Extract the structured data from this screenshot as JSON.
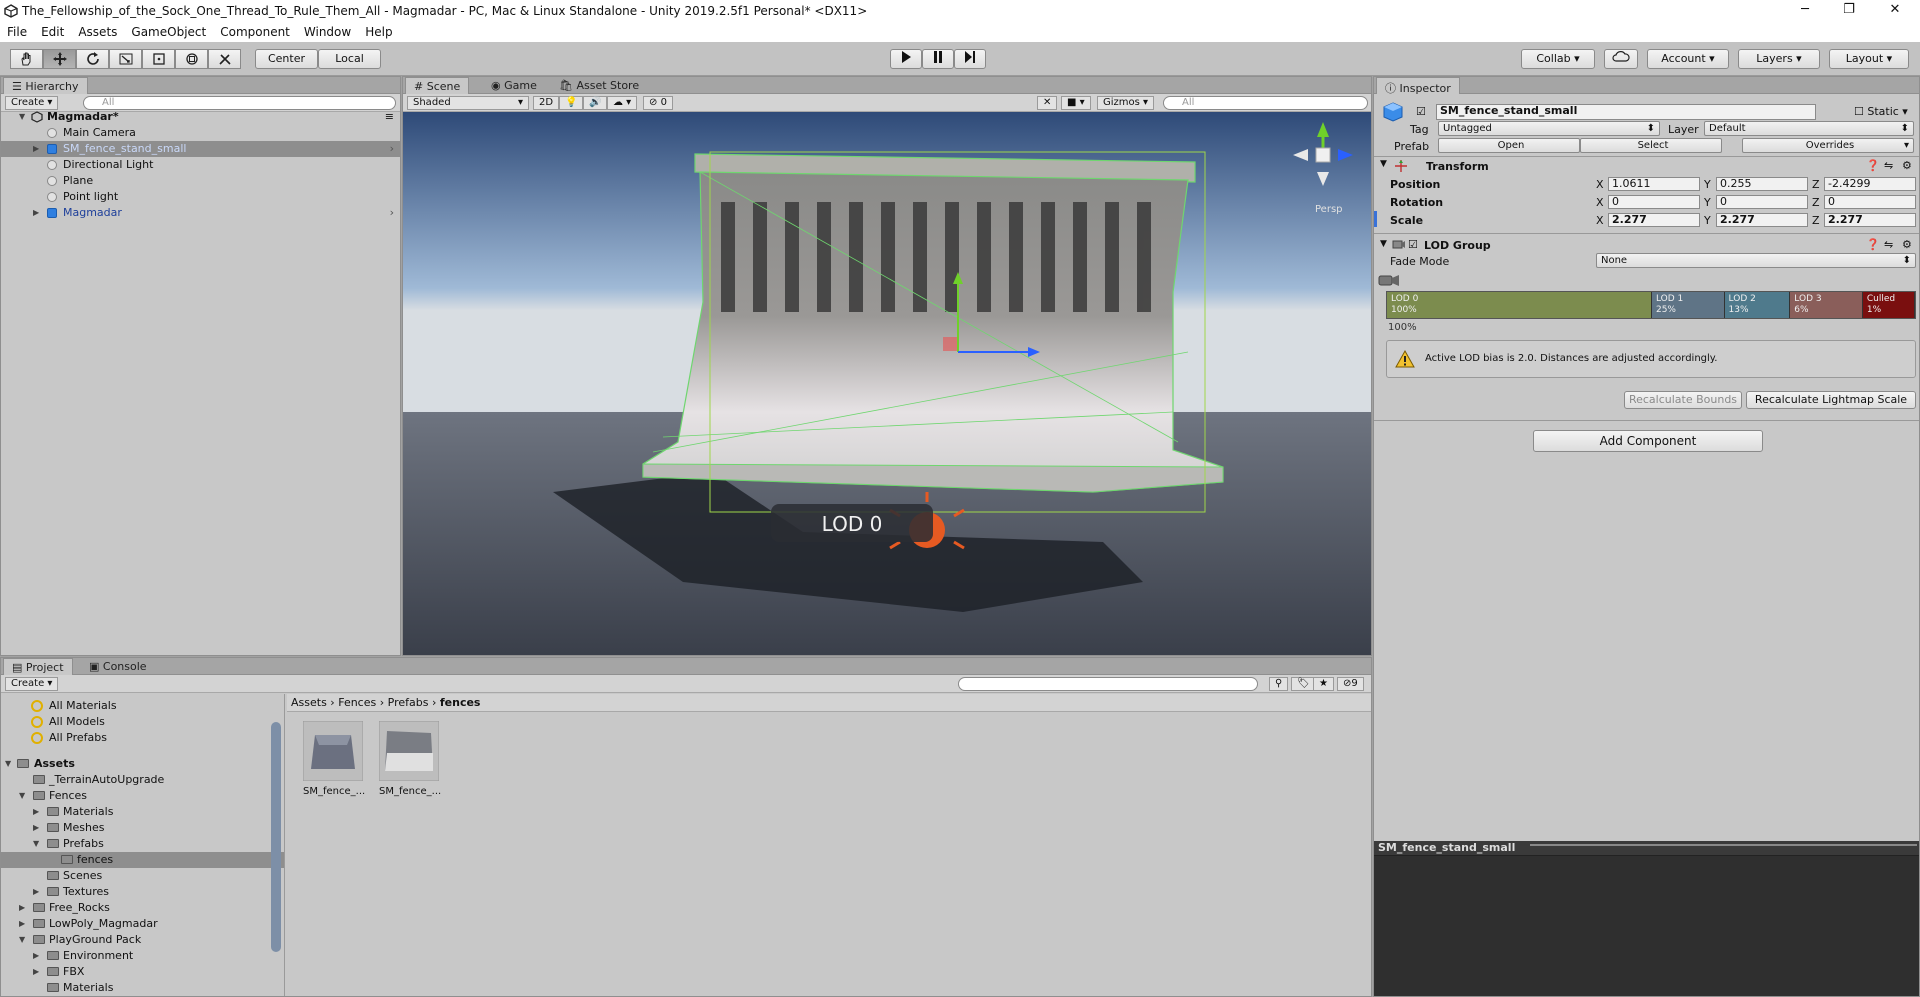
{
  "window": {
    "title": "The_Fellowship_of_the_Sock_One_Thread_To_Rule_Them_All - Magmadar - PC, Mac & Linux Standalone - Unity 2019.2.5f1 Personal* <DX11>",
    "minimize": "─",
    "maximize": "❐",
    "close": "✕"
  },
  "menu": [
    "File",
    "Edit",
    "Assets",
    "GameObject",
    "Component",
    "Window",
    "Help"
  ],
  "toolbar": {
    "pivot": "Center",
    "space": "Local",
    "collab": "Collab",
    "account": "Account",
    "layers": "Layers",
    "layout": "Layout"
  },
  "hierarchy": {
    "tab": "Hierarchy",
    "create": "Create",
    "search_placeholder": "All",
    "scene": "Magmadar*",
    "items": [
      "Main Camera",
      "SM_fence_stand_small",
      "Directional Light",
      "Plane",
      "Point light",
      "Magmadar"
    ]
  },
  "scene_view": {
    "tabs": [
      "Scene",
      "Game",
      "Asset Store"
    ],
    "shading": "Shaded",
    "mode_2d": "2D",
    "hidden_count": "0",
    "gizmos": "Gizmos",
    "search_placeholder": "All",
    "persp": "Persp",
    "lod_label": "LOD 0"
  },
  "project": {
    "tabs": [
      "Project",
      "Console"
    ],
    "create": "Create",
    "favorites": [
      "All Materials",
      "All Models",
      "All Prefabs"
    ],
    "tree": [
      {
        "label": "Assets",
        "bold": true
      },
      {
        "label": "_TerrainAutoUpgrade"
      },
      {
        "label": "Fences"
      },
      {
        "label": "Materials"
      },
      {
        "label": "Meshes"
      },
      {
        "label": "Prefabs"
      },
      {
        "label": "fences",
        "selected": true
      },
      {
        "label": "Scenes"
      },
      {
        "label": "Textures"
      },
      {
        "label": "Free_Rocks"
      },
      {
        "label": "LowPoly_Magmadar"
      },
      {
        "label": "PlayGround Pack"
      },
      {
        "label": "Environment"
      },
      {
        "label": "FBX"
      },
      {
        "label": "Materials"
      }
    ],
    "breadcrumb": [
      "Assets",
      "Fences",
      "Prefabs",
      "fences"
    ],
    "assets": [
      "SM_fence_...",
      "SM_fence_..."
    ],
    "hidden_count": "9"
  },
  "inspector": {
    "tab": "Inspector",
    "object_name": "SM_fence_stand_small",
    "static_label": "Static",
    "tag_label": "Tag",
    "tag_value": "Untagged",
    "layer_label": "Layer",
    "layer_value": "Default",
    "prefab_label": "Prefab",
    "prefab_open": "Open",
    "prefab_select": "Select",
    "prefab_overrides": "Overrides",
    "transform": {
      "title": "Transform",
      "position_label": "Position",
      "rotation_label": "Rotation",
      "scale_label": "Scale",
      "position": [
        "1.0611",
        "0.255",
        "-2.4299"
      ],
      "rotation": [
        "0",
        "0",
        "0"
      ],
      "scale": [
        "2.277",
        "2.277",
        "2.277"
      ],
      "axes": [
        "X",
        "Y",
        "Z"
      ]
    },
    "lod_group": {
      "title": "LOD Group",
      "fade_mode_label": "Fade Mode",
      "fade_mode": "None",
      "levels": [
        {
          "name": "LOD 0",
          "pct": "100%",
          "color": "#7c8c4e"
        },
        {
          "name": "LOD 1",
          "pct": "25%",
          "color": "#5f7486"
        },
        {
          "name": "LOD 2",
          "pct": "13%",
          "color": "#4f7a8c"
        },
        {
          "name": "LOD 3",
          "pct": "6%",
          "color": "#8a5e5a"
        },
        {
          "name": "Culled",
          "pct": "1%",
          "color": "#7a0f0f"
        }
      ],
      "lod0_fraction": 0.53,
      "top_pct": "100%",
      "warning": "Active LOD bias is 2.0. Distances are adjusted accordingly.",
      "recalc_bounds": "Recalculate Bounds",
      "recalc_lightmap": "Recalculate Lightmap Scale"
    },
    "add_component": "Add Component",
    "preview_title": "SM_fence_stand_small"
  }
}
